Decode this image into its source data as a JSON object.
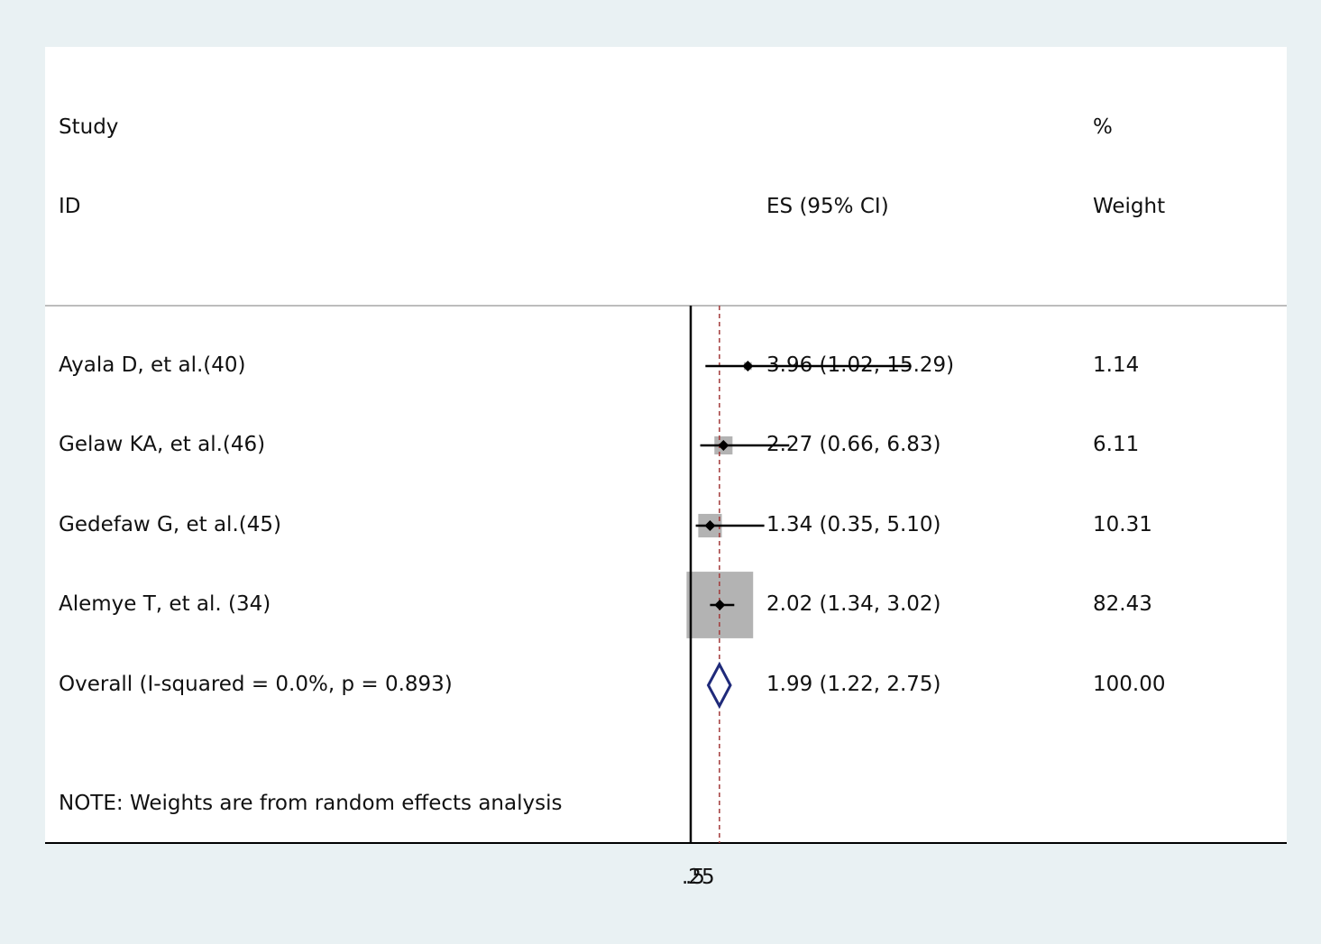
{
  "headers": {
    "study": "Study",
    "id": "ID",
    "es": "ES (95% CI)",
    "pct": "%",
    "weight": "Weight"
  },
  "chart_data": {
    "type": "forest",
    "x_ticks": [
      ".25",
      ".5"
    ],
    "null_line": 1,
    "studies": [
      {
        "label": "Ayala D, et al.(40)",
        "es": 3.96,
        "lo": 1.02,
        "hi": 15.29,
        "es_text": "3.96 (1.02, 15.29)",
        "weight": 1.14,
        "weight_text": "1.14"
      },
      {
        "label": "Gelaw KA, et al.(46)",
        "es": 2.27,
        "lo": 0.66,
        "hi": 6.83,
        "es_text": "2.27 (0.66, 6.83)",
        "weight": 6.11,
        "weight_text": "6.11"
      },
      {
        "label": "Gedefaw G, et al.(45)",
        "es": 1.34,
        "lo": 0.35,
        "hi": 5.1,
        "es_text": "1.34 (0.35, 5.10)",
        "weight": 10.31,
        "weight_text": "10.31"
      },
      {
        "label": "Alemye T, et al. (34)",
        "es": 2.02,
        "lo": 1.34,
        "hi": 3.02,
        "es_text": "2.02 (1.34, 3.02)",
        "weight": 82.43,
        "weight_text": "82.43"
      }
    ],
    "overall": {
      "label": "Overall  (I-squared = 0.0%, p = 0.893)",
      "es": 1.99,
      "lo": 1.22,
      "hi": 2.75,
      "es_text": "1.99 (1.22, 2.75)",
      "weight_text": "100.00"
    },
    "note": "NOTE: Weights are from random effects analysis",
    "colors": {
      "box": "#b3b3b3",
      "diamond": "#1f2a7a",
      "ref_line": "#a33a3a",
      "line": "#000000"
    }
  }
}
